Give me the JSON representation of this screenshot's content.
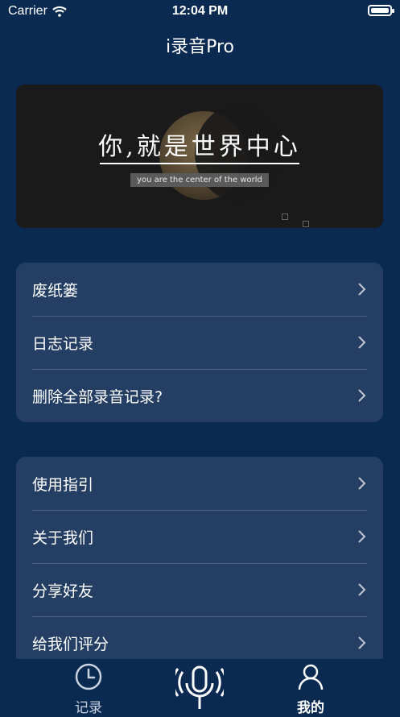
{
  "status": {
    "carrier": "Carrier",
    "time": "12:04 PM"
  },
  "header": {
    "title": "i录音Pro"
  },
  "banner": {
    "headline": "你,就是世界中心",
    "subtitle": "you are the center of the world"
  },
  "group1": {
    "items": [
      {
        "label": "废纸篓"
      },
      {
        "label": "日志记录"
      },
      {
        "label": "删除全部录音记录?"
      }
    ]
  },
  "group2": {
    "items": [
      {
        "label": "使用指引"
      },
      {
        "label": "关于我们"
      },
      {
        "label": "分享好友"
      },
      {
        "label": "给我们评分"
      }
    ]
  },
  "tabbar": {
    "tabs": [
      {
        "label": "记录",
        "icon": "clock-icon"
      },
      {
        "label": "",
        "icon": "microphone-icon"
      },
      {
        "label": "我的",
        "icon": "person-icon"
      }
    ],
    "selected": "我的"
  },
  "colors": {
    "background": "#0b2a52",
    "card": "#243f63",
    "divider": "#4a6282"
  }
}
